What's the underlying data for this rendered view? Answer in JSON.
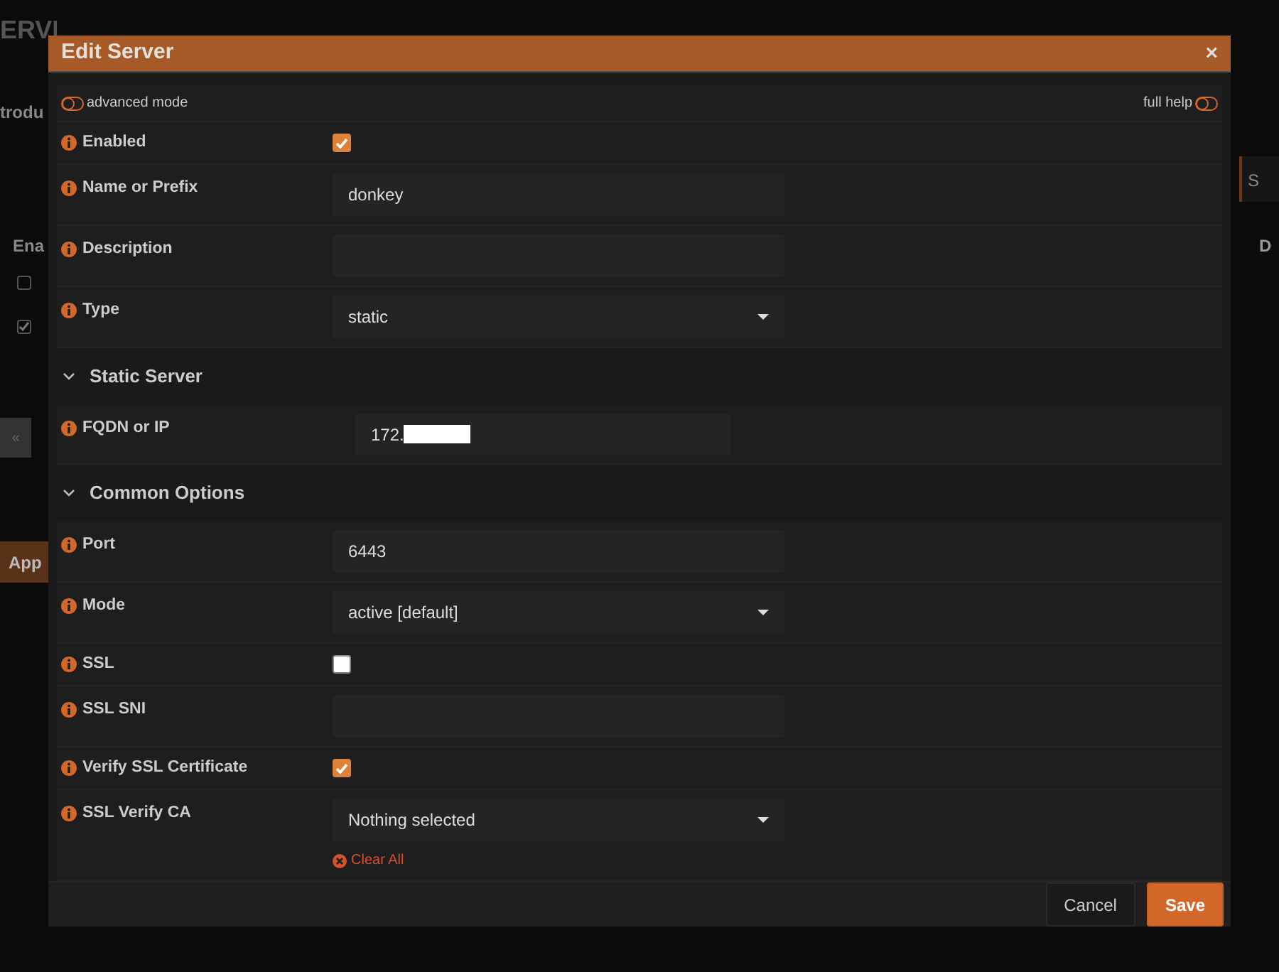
{
  "background": {
    "heading": "ERVI",
    "tab": "trodu",
    "column_1": "Ena",
    "column_2": "D",
    "search": "S",
    "pager": "«",
    "apply": "App",
    "checkboxes": [
      {
        "checked": false
      },
      {
        "checked": true
      }
    ]
  },
  "dialog": {
    "title": "Edit Server",
    "close": "×",
    "advanced_mode": {
      "label": "advanced mode",
      "on": false
    },
    "full_help": {
      "label": "full help",
      "on": false
    },
    "rows": [
      {
        "kind": "checkbox",
        "label": "Enabled",
        "checked": true
      },
      {
        "kind": "text",
        "label": "Name or Prefix",
        "value": "donkey"
      },
      {
        "kind": "text",
        "label": "Description"
      },
      {
        "kind": "select",
        "label": "Type",
        "value": "static"
      },
      {
        "kind": "section",
        "label": "Static Server",
        "expanded": true
      },
      {
        "kind": "redacted",
        "label": "FQDN or IP",
        "value": "172."
      },
      {
        "kind": "section",
        "label": "Common Options",
        "expanded": true
      },
      {
        "kind": "text",
        "label": "Port",
        "value": "6443"
      },
      {
        "kind": "select",
        "label": "Mode",
        "value": "active [default]"
      },
      {
        "kind": "checkbox",
        "label": "SSL",
        "checked": false
      },
      {
        "kind": "text",
        "label": "SSL SNI"
      },
      {
        "kind": "checkbox",
        "label": "Verify SSL Certificate",
        "checked": true
      },
      {
        "kind": "multiselect",
        "label": "SSL Verify CA",
        "value": "Nothing selected",
        "clear": "Clear All"
      }
    ],
    "buttons": [
      {
        "kind": "secondary",
        "label": "Cancel"
      },
      {
        "kind": "primary",
        "label": "Save"
      }
    ]
  }
}
